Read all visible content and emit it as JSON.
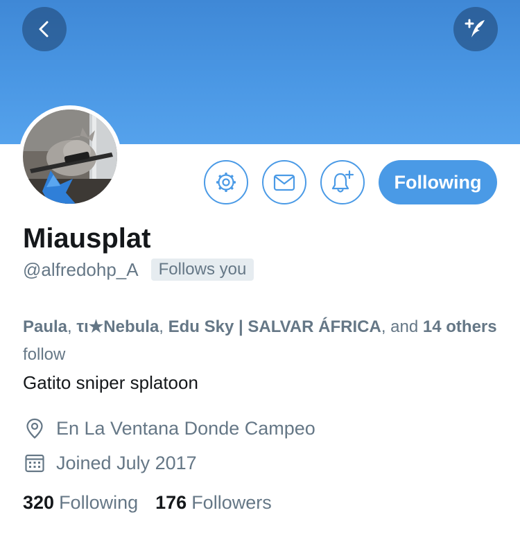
{
  "colors": {
    "accent": "#4a9ae6",
    "banner": "#4a97e4",
    "muted_text": "#657786",
    "primary_text": "#14171a"
  },
  "header": {
    "back_icon": "chevron-left-icon",
    "compose_icon": "compose-tweet-icon"
  },
  "profile": {
    "avatar_icon": "kitten-sniper-avatar",
    "display_name": "Miausplat",
    "handle": "@alfredohp_A",
    "follows_you_badge": "Follows you",
    "bio": "Gatito sniper splatoon",
    "location": "En La Ventana Donde Campeo",
    "joined": "Joined July 2017"
  },
  "actions": {
    "settings_icon": "gear-icon",
    "message_icon": "envelope-icon",
    "notify_icon": "bell-plus-icon",
    "following_label": "Following"
  },
  "followed_by": {
    "names": [
      "Paula",
      "τι★Nebula",
      "Edu Sky | SALVAR ÁFRICA"
    ],
    "separator": ", ",
    "and_text": ", and ",
    "others_count": "14",
    "others_label": "others",
    "suffix": " follow"
  },
  "stats": {
    "following_count": "320",
    "following_label": "Following",
    "followers_count": "176",
    "followers_label": "Followers"
  }
}
